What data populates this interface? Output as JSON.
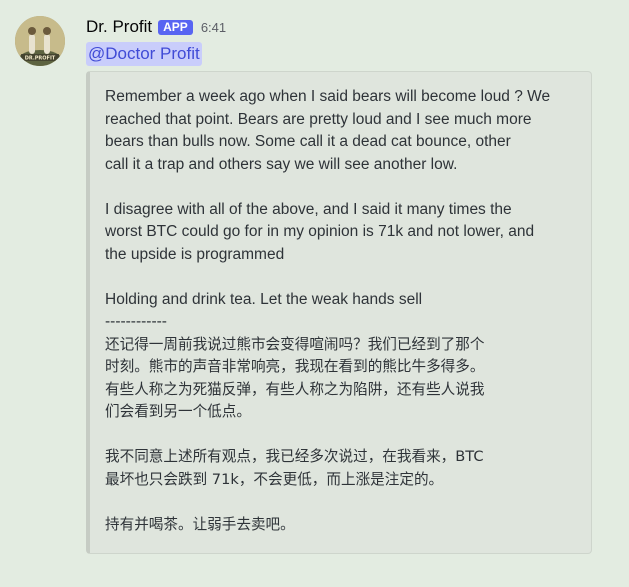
{
  "message": {
    "author": "Dr. Profit",
    "badge": "APP",
    "time": "6:41",
    "mention": "@Doctor Profit",
    "avatar": {
      "icon": "avatar-icon",
      "text": "DR.PROFIT"
    },
    "embed": {
      "lines": [
        "Remember a week ago when I said bears will become loud ? We",
        "reached that point. Bears are pretty loud and I see much more",
        "bears than bulls now. Some call it a dead cat bounce, other",
        "call it a trap and others say we will see another low.",
        "",
        "I disagree with all of the above, and I said it many times the",
        "worst BTC could go for in my opinion is 71k and not lower, and",
        "the upside is programmed",
        "",
        "Holding and drink tea. Let the weak hands sell",
        "------------",
        "还记得一周前我说过熊市会变得喧闹吗？我们已经到了那个",
        "时刻。熊市的声音非常响亮，我现在看到的熊比牛多得多。",
        "有些人称之为死猫反弹，有些人称之为陷阱，还有些人说我",
        "们会看到另一个低点。",
        "",
        "我不同意上述所有观点，我已经多次说过，在我看来，BTC",
        "最坏也只会跌到 71k，不会更低，而上涨是注定的。",
        "",
        "持有并喝茶。让弱手去卖吧。"
      ]
    }
  },
  "colors": {
    "background": "#e3ece1",
    "badge": "#5865f2",
    "mention_bg": "#c9cdfb",
    "mention_text": "#404bd6",
    "embed_bg": "#dfe5dd"
  }
}
